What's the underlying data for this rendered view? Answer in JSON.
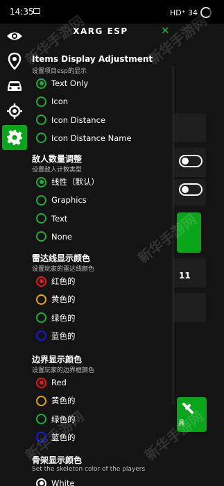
{
  "status_bar": {
    "time": "14:35",
    "right_text": "HD⁺ 34"
  },
  "menu": {
    "title": "XARG ESP"
  },
  "background": {
    "number": "11",
    "green_button_label": "具"
  },
  "watermark": "新华手游网",
  "colors": {
    "accent": "#0aa51a",
    "red": "#e01b1b",
    "yellow": "#e6a817",
    "green": "#1db03a",
    "blue": "#1a1ad9"
  },
  "sidebar": {
    "items": [
      {
        "icon": "eye-icon"
      },
      {
        "icon": "location-pin-icon"
      },
      {
        "icon": "car-icon"
      },
      {
        "icon": "crosshair-icon"
      },
      {
        "icon": "gear-icon",
        "active": true
      }
    ]
  },
  "sections": [
    {
      "title": "Items Display Adjustment",
      "subtitle": "设置项目esp的显示",
      "options": [
        {
          "label": "Text Only",
          "selected": true,
          "color": "green"
        },
        {
          "label": "Icon",
          "selected": false,
          "color": "green"
        },
        {
          "label": "Icon Distance",
          "selected": false,
          "color": "green"
        },
        {
          "label": "Icon Distance Name",
          "selected": false,
          "color": "green"
        }
      ]
    },
    {
      "title": "敌人数量调整",
      "subtitle": "设置敌人计数类型",
      "options": [
        {
          "label": "线性（默认）",
          "selected": true,
          "color": "green"
        },
        {
          "label": "Graphics",
          "selected": false,
          "color": "green"
        },
        {
          "label": "Text",
          "selected": false,
          "color": "green"
        },
        {
          "label": "None",
          "selected": false,
          "color": "green"
        }
      ]
    },
    {
      "title": "雷达线显示颜色",
      "subtitle": "设置玩家的雷达线颜色",
      "options": [
        {
          "label": "红色的",
          "selected": true,
          "color": "red"
        },
        {
          "label": "黄色的",
          "selected": false,
          "color": "yellow"
        },
        {
          "label": "绿色的",
          "selected": false,
          "color": "green"
        },
        {
          "label": "蓝色的",
          "selected": false,
          "color": "blue"
        }
      ]
    },
    {
      "title": "边界显示颜色",
      "subtitle": "设置玩家的边界框颜色",
      "options": [
        {
          "label": "Red",
          "selected": true,
          "color": "red"
        },
        {
          "label": "黄色的",
          "selected": false,
          "color": "yellow"
        },
        {
          "label": "绿色的",
          "selected": false,
          "color": "green"
        },
        {
          "label": "蓝色的",
          "selected": false,
          "color": "blue"
        }
      ]
    },
    {
      "title": "骨架显示颜色",
      "subtitle": "Set the skeleton color of the players",
      "options": [
        {
          "label": "White",
          "selected": true,
          "color": "white"
        }
      ]
    }
  ]
}
